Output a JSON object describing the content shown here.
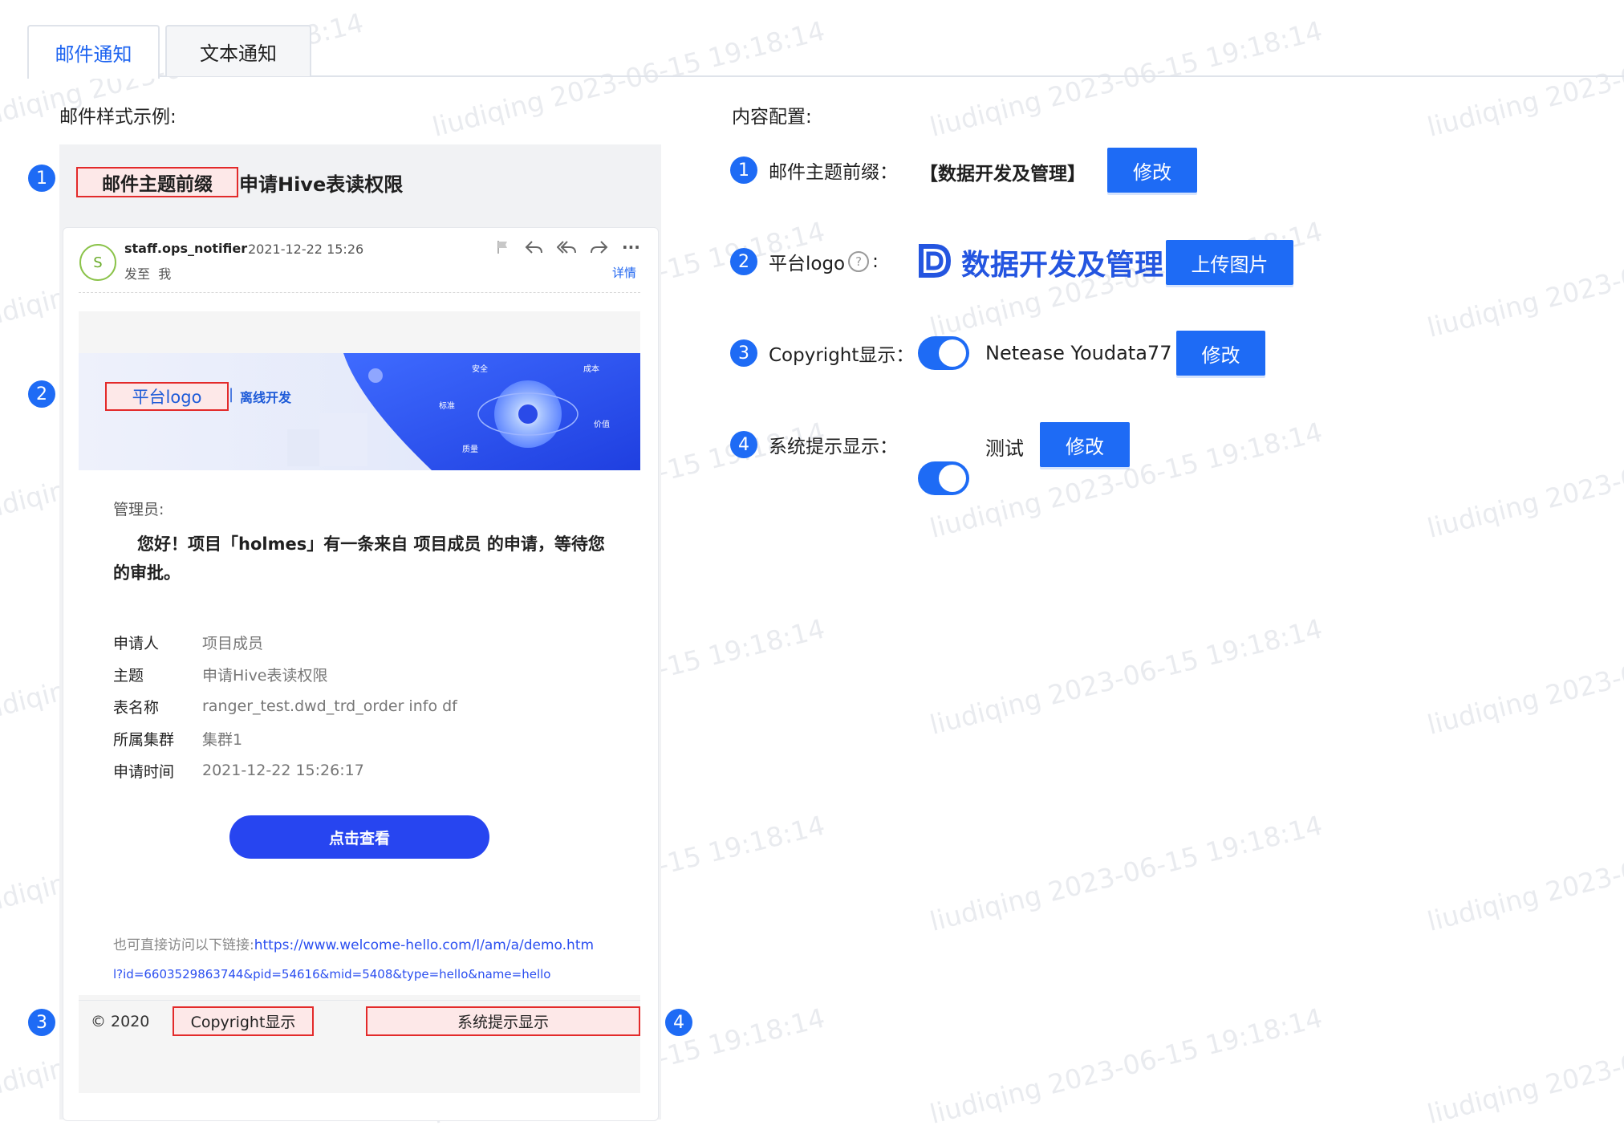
{
  "tabs": [
    {
      "label": "邮件通知",
      "active": true
    },
    {
      "label": "文本通知",
      "active": false
    }
  ],
  "preview_label": "邮件样式示例:",
  "config_label": "内容配置:",
  "badges": [
    "1",
    "2",
    "3",
    "4"
  ],
  "preview": {
    "subject_prefix": "邮件主题前缀",
    "subject": "申请Hive表读权限",
    "avatar_letter": "S",
    "sender": "staff.ops_notifier",
    "time": "2021-12-22 15:26",
    "sent_to_label": "发至",
    "sent_to": "我",
    "detail_link": "详情",
    "logo_label": "平台logo",
    "logo_sep": "|",
    "logo_subtitle": "离线开发",
    "banner_tags": [
      "安全",
      "成本",
      "标准",
      "价值",
      "质量"
    ],
    "greeting": "管理员:",
    "message": "您好！项目「holmes」有一条来自 项目成员 的申请，等待您的审批。",
    "info": [
      {
        "key": "申请人",
        "value": "项目成员"
      },
      {
        "key": "主题",
        "value": "申请Hive表读权限"
      },
      {
        "key": "表名称",
        "value": "ranger_test.dwd_trd_order info df"
      },
      {
        "key": "所属集群",
        "value": "集群1"
      },
      {
        "key": "申请时间",
        "value": "2021-12-22 15:26:17"
      }
    ],
    "view_button": "点击查看",
    "link_prefix": "也可直接访问以下链接:",
    "link_url_1": "https://www.welcome-hello.com/l/am/a/demo.htm",
    "link_url_2": "l?id=6603529863744&pid=54616&mid=5408&type=hello&name=hello",
    "copyright_year": "© 2020",
    "copyright_label": "Copyright显示",
    "system_tip_label": "系统提示显示"
  },
  "config": {
    "subject_prefix": {
      "label": "邮件主题前缀：",
      "value": "【数据开发及管理】",
      "button": "修改"
    },
    "logo": {
      "label_a": "平台logo",
      "help": "?",
      "label_b": ":",
      "logo_text": "数据开发及管理",
      "button": "上传图片"
    },
    "copyright": {
      "label": "Copyright显示：",
      "enabled": true,
      "value": "Netease Youdata77",
      "button": "修改"
    },
    "system_tip": {
      "label": "系统提示显示：",
      "enabled": true,
      "value": "测试",
      "button": "修改"
    }
  },
  "watermark": "liudiqing 2023-06-15 19:18:14",
  "colors": {
    "accent": "#1e6bf5",
    "highlight_border": "#e32a2a",
    "highlight_fill": "#fde8e8",
    "view_button": "#2745f0"
  }
}
